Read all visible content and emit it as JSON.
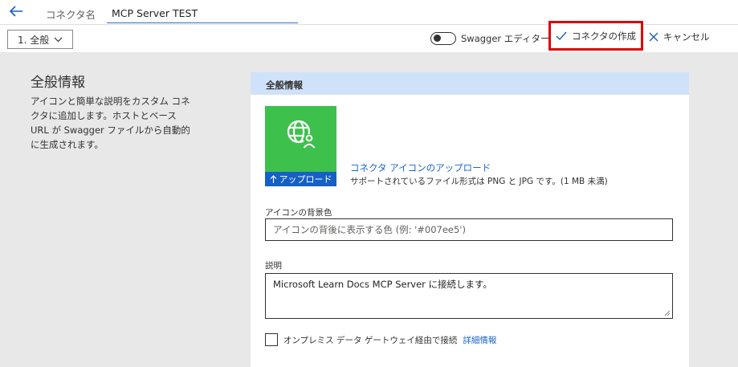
{
  "header": {
    "back_icon": "arrow-left-icon",
    "connector_name_label": "コネクタ名",
    "connector_name_value": "MCP Server TEST"
  },
  "toolbar": {
    "section_dropdown_label": "1. 全般",
    "swagger_toggle_label": "Swagger エディター",
    "swagger_toggle_on": false,
    "create_button_label": "コネクタの作成",
    "create_button_icon": "checkmark-icon",
    "cancel_button_label": "キャンセル",
    "cancel_button_icon": "close-icon"
  },
  "side": {
    "title": "全般情報",
    "description": "アイコンと簡単な説明をカスタム コネクタに追加します。ホストとベース URL が Swagger ファイルから自動的に生成されます。"
  },
  "card": {
    "header": "全般情報",
    "icon_background_color": "#3ec04d",
    "icon_name": "globe-person-icon",
    "upload_button_label": "アップロード",
    "upload_link": "コネクタ アイコンのアップロード",
    "upload_hint": "サポートされているファイル形式は PNG と JPG です。(1 MB 未満)",
    "bg_color_label": "アイコンの背景色",
    "bg_color_placeholder": "アイコンの背後に表示する色 (例: '#007ee5')",
    "description_label": "説明",
    "description_value": "Microsoft Learn Docs MCP Server に接続します。",
    "gateway_label": "オンプレミス データ ゲートウェイ経由で接続",
    "gateway_link": "詳細情報"
  },
  "colors": {
    "accent": "#1560c4",
    "highlight_border": "#e00000",
    "card_header_bg": "#cfe2f9",
    "page_bg": "#e8e8e8"
  }
}
